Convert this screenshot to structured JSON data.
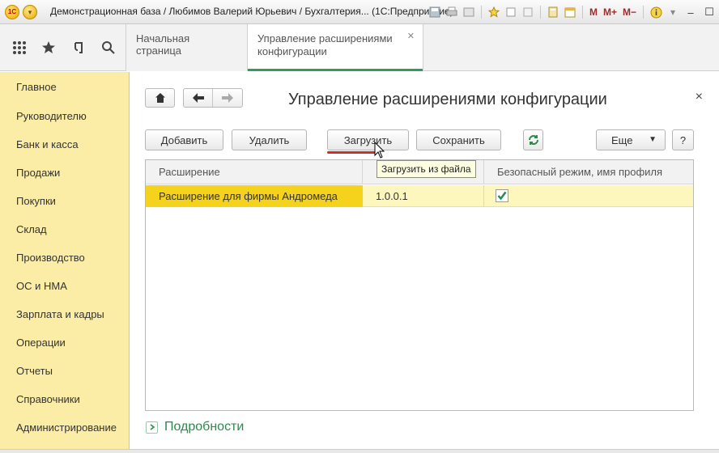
{
  "titlebar": {
    "logo_text": "1C",
    "title": "Демонстрационная база / Любимов Валерий Юрьевич / Бухгалтерия... (1С:Предприятие)",
    "m_label": "M",
    "mplus_label": "M+",
    "mminus_label": "M−"
  },
  "tabs": [
    {
      "label": "Начальная страница"
    },
    {
      "label": "Управление расширениями конфигурации"
    }
  ],
  "sidebar": {
    "items": [
      {
        "label": "Главное"
      },
      {
        "label": "Руководителю"
      },
      {
        "label": "Банк и касса"
      },
      {
        "label": "Продажи"
      },
      {
        "label": "Покупки"
      },
      {
        "label": "Склад"
      },
      {
        "label": "Производство"
      },
      {
        "label": "ОС и НМА"
      },
      {
        "label": "Зарплата и кадры"
      },
      {
        "label": "Операции"
      },
      {
        "label": "Отчеты"
      },
      {
        "label": "Справочники"
      },
      {
        "label": "Администрирование"
      }
    ]
  },
  "page": {
    "title": "Управление расширениями конфигурации",
    "close": "×"
  },
  "toolbar": {
    "add": "Добавить",
    "delete": "Удалить",
    "load": "Загрузить",
    "save": "Сохранить",
    "more": "Еще",
    "help": "?"
  },
  "tooltip": "Загрузить из файла",
  "table": {
    "columns": [
      "Расширение",
      "",
      "Безопасный режим, имя профиля"
    ],
    "rows": [
      {
        "name": "Расширение для фирмы Андромеда",
        "version": "1.0.0.1",
        "safe_mode": true
      }
    ]
  },
  "details": {
    "label": "Подробности"
  },
  "colors": {
    "sidebar_bg": "#fbeda6",
    "selected_row": "#fdf7bd",
    "selected_cell": "#f5d21c",
    "accent_green": "#2c8a4a",
    "underline_red": "#d32a2a"
  }
}
